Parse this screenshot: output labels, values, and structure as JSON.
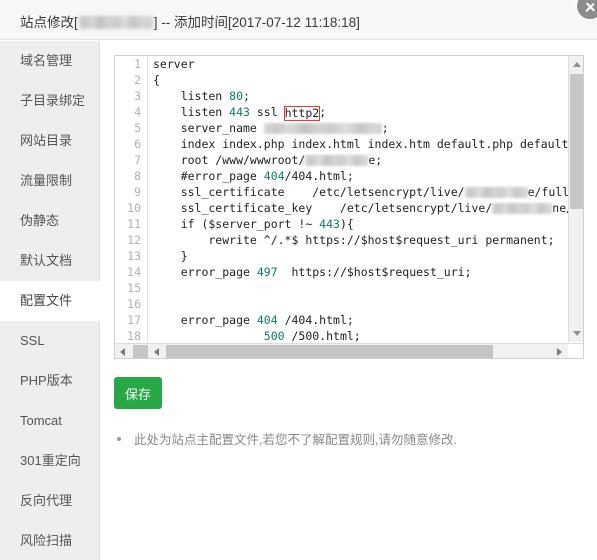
{
  "header": {
    "title_prefix": "站点修改[",
    "title_masked": "",
    "title_suffix": "] -- 添加时间[2017-07-12 11:18:18]",
    "close_icon": "close-icon"
  },
  "sidebar": {
    "items": [
      {
        "label": "域名管理",
        "active": false
      },
      {
        "label": "子目录绑定",
        "active": false
      },
      {
        "label": "网站目录",
        "active": false
      },
      {
        "label": "流量限制",
        "active": false
      },
      {
        "label": "伪静态",
        "active": false
      },
      {
        "label": "默认文档",
        "active": false
      },
      {
        "label": "配置文件",
        "active": true
      },
      {
        "label": "SSL",
        "active": false
      },
      {
        "label": "PHP版本",
        "active": false
      },
      {
        "label": "Tomcat",
        "active": false
      },
      {
        "label": "301重定向",
        "active": false
      },
      {
        "label": "反向代理",
        "active": false
      },
      {
        "label": "风险扫描",
        "active": false
      }
    ]
  },
  "editor": {
    "line_numbers": [
      1,
      2,
      3,
      4,
      5,
      6,
      7,
      8,
      9,
      10,
      11,
      12,
      13,
      14,
      15,
      16,
      17,
      18
    ],
    "lines": [
      {
        "n": 1,
        "tokens": [
          {
            "t": "text",
            "v": "server"
          }
        ]
      },
      {
        "n": 2,
        "tokens": [
          {
            "t": "text",
            "v": "{"
          }
        ]
      },
      {
        "n": 3,
        "tokens": [
          {
            "t": "text",
            "v": "    listen "
          },
          {
            "t": "num",
            "v": "80"
          },
          {
            "t": "text",
            "v": ";"
          }
        ]
      },
      {
        "n": 4,
        "tokens": [
          {
            "t": "text",
            "v": "    listen "
          },
          {
            "t": "num",
            "v": "443"
          },
          {
            "t": "text",
            "v": " ssl "
          },
          {
            "t": "hl",
            "v": "http2"
          },
          {
            "t": "text",
            "v": ";"
          }
        ]
      },
      {
        "n": 5,
        "tokens": [
          {
            "t": "text",
            "v": "    server_name "
          },
          {
            "t": "blur",
            "w": "118"
          },
          {
            "t": "text",
            "v": ";"
          }
        ]
      },
      {
        "n": 6,
        "tokens": [
          {
            "t": "text",
            "v": "    index index.php index.html index.htm default.php default.htm defau"
          }
        ]
      },
      {
        "n": 7,
        "tokens": [
          {
            "t": "text",
            "v": "    root /www/wwwroot/"
          },
          {
            "t": "blur",
            "w": "63"
          },
          {
            "t": "text",
            "v": "e;"
          }
        ]
      },
      {
        "n": 8,
        "tokens": [
          {
            "t": "text",
            "v": "    #error_page "
          },
          {
            "t": "num",
            "v": "404"
          },
          {
            "t": "text",
            "v": "/404.html;"
          }
        ]
      },
      {
        "n": 9,
        "tokens": [
          {
            "t": "text",
            "v": "    ssl_certificate    /etc/letsencrypt/live/"
          },
          {
            "t": "blur",
            "w": "63"
          },
          {
            "t": "text",
            "v": "e/fullchain.pem"
          }
        ]
      },
      {
        "n": 10,
        "tokens": [
          {
            "t": "text",
            "v": "    ssl_certificate_key    /etc/letsencrypt/live/"
          },
          {
            "t": "blur",
            "w": "60"
          },
          {
            "t": "text",
            "v": "ne/privkey.p"
          }
        ]
      },
      {
        "n": 11,
        "tokens": [
          {
            "t": "text",
            "v": "    if ($server_port !~ "
          },
          {
            "t": "num",
            "v": "443"
          },
          {
            "t": "text",
            "v": "){"
          }
        ]
      },
      {
        "n": 12,
        "tokens": [
          {
            "t": "text",
            "v": "        rewrite ^/.*$ https://$host$request_uri permanent;"
          }
        ]
      },
      {
        "n": 13,
        "tokens": [
          {
            "t": "text",
            "v": "    }"
          }
        ]
      },
      {
        "n": 14,
        "tokens": [
          {
            "t": "text",
            "v": "    error_page "
          },
          {
            "t": "num",
            "v": "497"
          },
          {
            "t": "text",
            "v": "  https://$host$request_uri;"
          }
        ]
      },
      {
        "n": 15,
        "tokens": [
          {
            "t": "text",
            "v": ""
          }
        ]
      },
      {
        "n": 16,
        "tokens": [
          {
            "t": "text",
            "v": ""
          }
        ]
      },
      {
        "n": 17,
        "tokens": [
          {
            "t": "text",
            "v": "    error_page "
          },
          {
            "t": "num",
            "v": "404"
          },
          {
            "t": "text",
            "v": " /404.html;"
          }
        ]
      },
      {
        "n": 18,
        "tokens": [
          {
            "t": "text",
            "v": "                "
          },
          {
            "t": "num",
            "v": "500"
          },
          {
            "t": "text",
            "v": " /500.html;"
          }
        ]
      }
    ],
    "highlight_color": "#e33b2e",
    "number_token_color": "#0b7a68"
  },
  "actions": {
    "save_label": "保存"
  },
  "note": {
    "text": "此处为站点主配置文件,若您不了解配置规则,请勿随意修改."
  }
}
